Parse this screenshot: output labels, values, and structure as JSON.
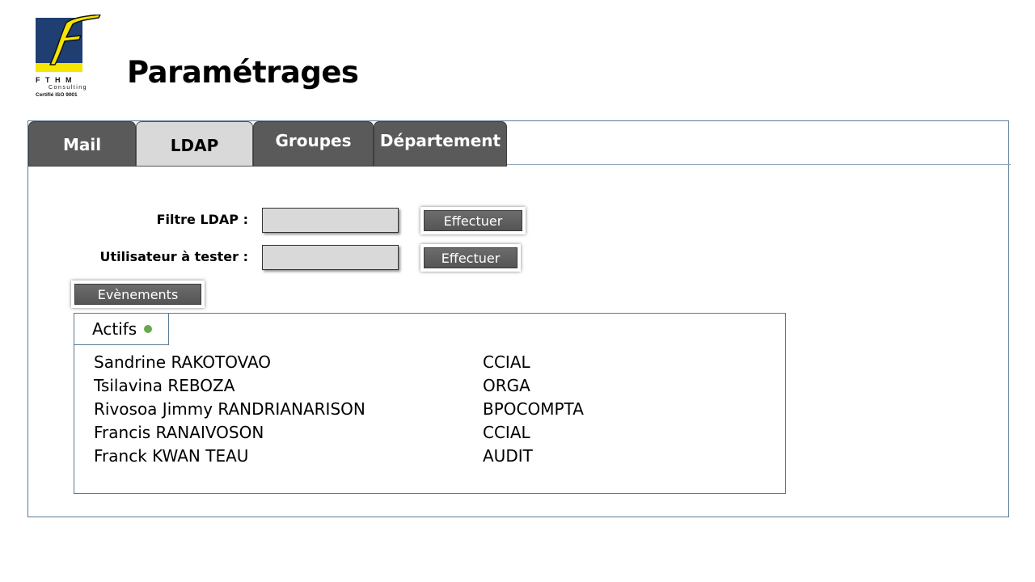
{
  "logo": {
    "brand": "FTHM",
    "subtitle": "Consulting",
    "certification": "Certifié ISO 9001"
  },
  "page": {
    "title": "Paramétrages"
  },
  "tabs": [
    {
      "label": "Mail",
      "active": false
    },
    {
      "label": "LDAP",
      "active": true
    },
    {
      "label": "Groupes",
      "active": false
    },
    {
      "label": "Département",
      "active": false
    }
  ],
  "form": {
    "filtre_label": "Filtre LDAP :",
    "filtre_value": "",
    "user_label": "Utilisateur à tester :",
    "user_value": "",
    "effectuer_label": "Effectuer",
    "evenements_label": "Evènements"
  },
  "actifs": {
    "title": "Actifs",
    "status_color": "#6aa84f",
    "users": [
      {
        "name": "Sandrine RAKOTOVAO",
        "dept": "CCIAL"
      },
      {
        "name": "Tsilavina REBOZA",
        "dept": "ORGA"
      },
      {
        "name": "Rivosoa Jimmy RANDRIANARISON",
        "dept": "BPOCOMPTA"
      },
      {
        "name": "Francis RANAIVOSON",
        "dept": "CCIAL"
      },
      {
        "name": "Franck KWAN TEAU",
        "dept": "AUDIT"
      }
    ]
  },
  "colors": {
    "tab_inactive": "#5a5a5a",
    "tab_active": "#d9d9d9",
    "border_blue": "#5a7a95",
    "logo_blue": "#1f3f73",
    "logo_yellow": "#f5e500"
  }
}
